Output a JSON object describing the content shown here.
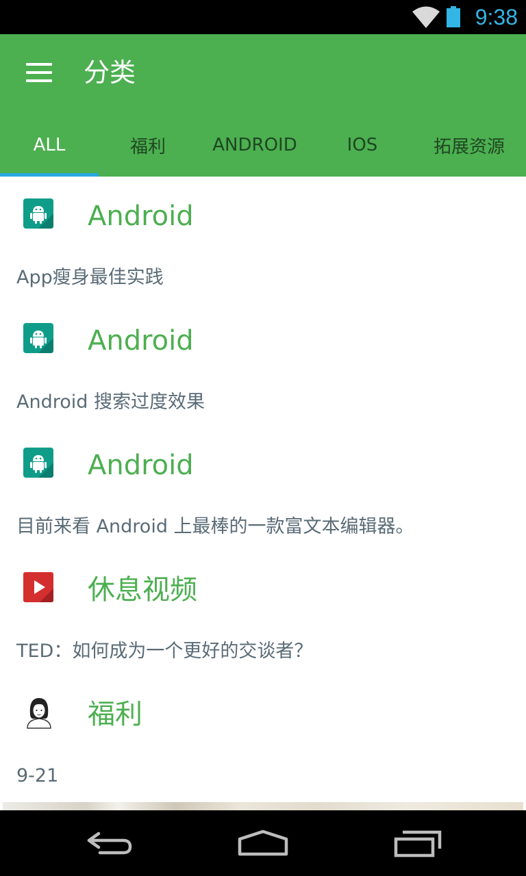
{
  "status_bar": {
    "time": "9:38",
    "icons": [
      "wifi-icon",
      "battery-icon"
    ]
  },
  "toolbar": {
    "title": "分类",
    "menu_icon": "hamburger-menu-icon"
  },
  "tabs": [
    {
      "label": "ALL",
      "active": true
    },
    {
      "label": "福利",
      "active": false
    },
    {
      "label": "ANDROID",
      "active": false
    },
    {
      "label": "IOS",
      "active": false
    },
    {
      "label": "拓展资源",
      "active": false
    }
  ],
  "feed": {
    "items": [
      {
        "type": "Android",
        "icon": "android-icon",
        "description": "App瘦身最佳实践"
      },
      {
        "type": "Android",
        "icon": "android-icon",
        "description": "Android 搜索过度效果"
      },
      {
        "type": "Android",
        "icon": "android-icon",
        "description": "目前来看 Android 上最棒的一款富文本编辑器。"
      },
      {
        "type": "休息视频",
        "icon": "video-play-icon",
        "description": "TED：如何成为一个更好的交谈者？"
      },
      {
        "type": "福利",
        "icon": "girl-avatar-icon",
        "description": "9-21"
      }
    ]
  },
  "nav_bar": {
    "buttons": [
      "back-icon",
      "home-icon",
      "recent-apps-icon"
    ]
  },
  "colors": {
    "primary": "#4caf50",
    "accent": "#29a8e0",
    "status_time": "#33b5e5",
    "text_secondary": "#5a6b76"
  }
}
